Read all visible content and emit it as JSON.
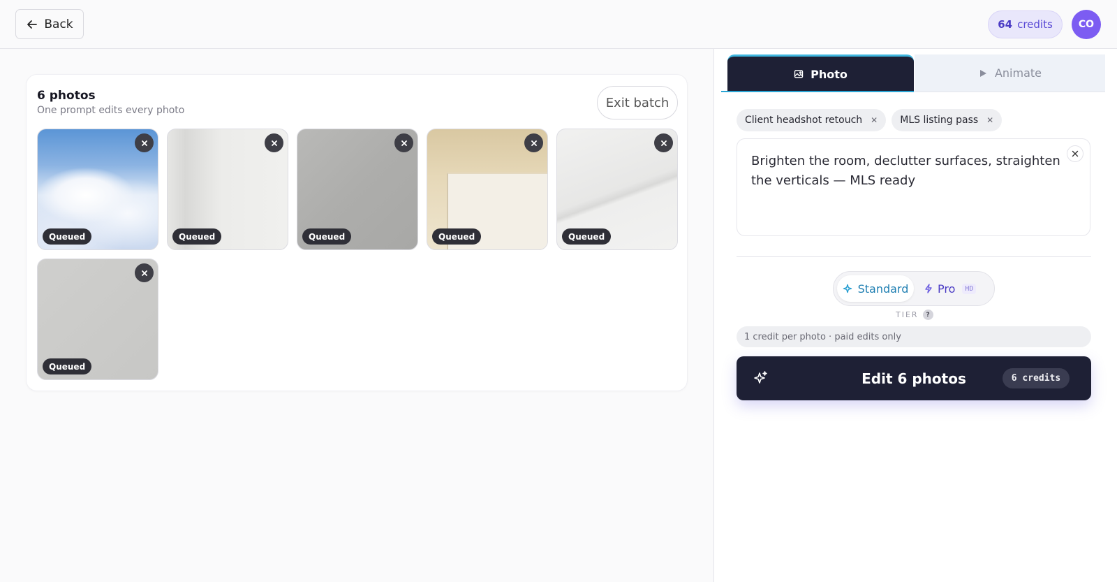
{
  "header": {
    "back_label": "Back",
    "credits_count": "64",
    "credits_label": "credits",
    "avatar_initials": "CO"
  },
  "batch": {
    "title": "6 photos",
    "subtitle": "One prompt edits every photo",
    "exit_label": "Exit batch",
    "photos": [
      {
        "status": "Queued"
      },
      {
        "status": "Queued"
      },
      {
        "status": "Queued"
      },
      {
        "status": "Queued"
      },
      {
        "status": "Queued"
      },
      {
        "status": "Queued"
      }
    ]
  },
  "panel": {
    "tabs": [
      {
        "label": "Photo",
        "icon": "image-icon",
        "active": true
      },
      {
        "label": "Animate",
        "icon": "play-icon",
        "active": false
      }
    ],
    "presets": [
      {
        "label": "Client headshot retouch"
      },
      {
        "label": "MLS listing pass"
      }
    ],
    "prompt": "Brighten the room, declutter surfaces, straighten the verticals — MLS ready",
    "tiers": {
      "standard_label": "Standard",
      "pro_label": "Pro",
      "pro_badge": "HD",
      "selected": "Standard"
    },
    "tier_caption": "TIER",
    "help_mark": "?",
    "cost_note": "1 credit per photo · paid edits only",
    "edit_button_label": "Edit 6 photos",
    "edit_button_cost": "6 credits"
  },
  "colors": {
    "primary_dark": "#1e2035",
    "accent_purple": "#7c5cf2",
    "accent_blue": "#1f7fb2"
  }
}
